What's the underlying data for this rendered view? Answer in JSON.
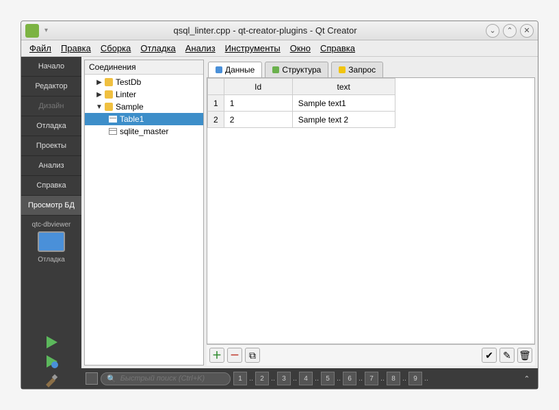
{
  "titlebar": {
    "title": "qsql_linter.cpp - qt-creator-plugins - Qt Creator"
  },
  "menubar": [
    "Файл",
    "Правка",
    "Сборка",
    "Отладка",
    "Анализ",
    "Инструменты",
    "Окно",
    "Справка"
  ],
  "sidebar": {
    "items": [
      {
        "label": "Начало"
      },
      {
        "label": "Редактор"
      },
      {
        "label": "Дизайн",
        "disabled": true
      },
      {
        "label": "Отладка"
      },
      {
        "label": "Проекты"
      },
      {
        "label": "Анализ"
      },
      {
        "label": "Справка"
      },
      {
        "label": "Просмотр БД",
        "active": true
      }
    ],
    "qtc_label": "qtc-dbviewer",
    "debug_label": "Отладка"
  },
  "tree": {
    "header": "Соединения",
    "roots": [
      {
        "label": "TestDb",
        "expanded": false,
        "type": "db"
      },
      {
        "label": "Linter",
        "expanded": false,
        "type": "db"
      },
      {
        "label": "Sample",
        "expanded": true,
        "type": "db",
        "children": [
          {
            "label": "Table1",
            "type": "table",
            "selected": true
          },
          {
            "label": "sqlite_master",
            "type": "table"
          }
        ]
      }
    ]
  },
  "tabs": [
    {
      "label": "Данные",
      "active": true,
      "color": "blue"
    },
    {
      "label": "Структура",
      "color": "green"
    },
    {
      "label": "Запрос",
      "color": "yellow"
    }
  ],
  "table": {
    "columns": [
      "Id",
      "text"
    ],
    "rows": [
      {
        "num": "1",
        "cells": [
          "1",
          "Sample text1"
        ]
      },
      {
        "num": "2",
        "cells": [
          "2",
          "Sample text 2"
        ]
      }
    ]
  },
  "search": {
    "placeholder": "Быстрый поиск (Ctrl+K)"
  },
  "pager": [
    "1",
    "2",
    "3",
    "4",
    "5",
    "6",
    "7",
    "8",
    "9"
  ]
}
